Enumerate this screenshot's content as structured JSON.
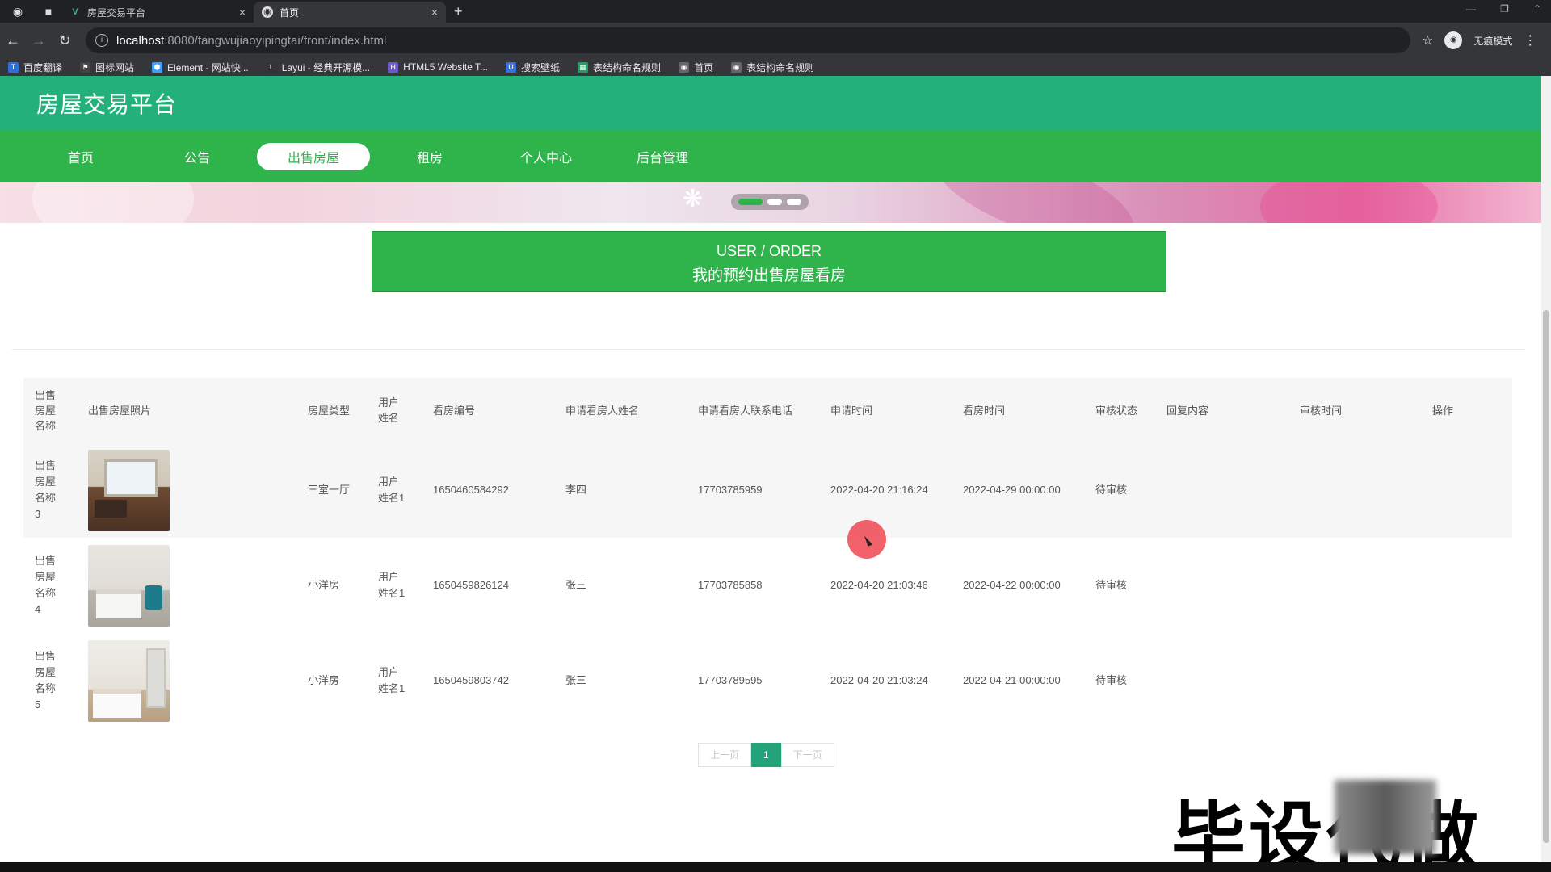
{
  "browser": {
    "tabs": [
      {
        "label": "房屋交易平台",
        "active": false
      },
      {
        "label": "首页",
        "active": true
      }
    ],
    "url_host": "localhost",
    "url_path": ":8080/fangwujiaoyipingtai/front/index.html",
    "incognito_label": "无痕模式",
    "bookmarks": [
      "百度翻译",
      "图标网站",
      "Element - 网站快...",
      "Layui - 经典开源模...",
      "HTML5 Website T...",
      "搜索壁纸",
      "表结构命名规则",
      "首页",
      "表结构命名规则"
    ]
  },
  "site": {
    "title": "房屋交易平台",
    "nav": [
      "首页",
      "公告",
      "出售房屋",
      "租房",
      "个人中心",
      "后台管理"
    ],
    "active_nav": "出售房屋"
  },
  "section": {
    "title_en": "USER / ORDER",
    "title_cn": "我的预约出售房屋看房"
  },
  "table": {
    "headers": [
      "出售房屋名称",
      "出售房屋照片",
      "房屋类型",
      "用户姓名",
      "看房编号",
      "申请看房人姓名",
      "申请看房人联系电话",
      "申请时间",
      "看房时间",
      "审核状态",
      "回复内容",
      "审核时间",
      "操作"
    ],
    "rows": [
      {
        "name": "出售房屋名称3",
        "photo": "living-room-photo",
        "type": "三室一厅",
        "user": "用户姓名1",
        "view_no": "1650460584292",
        "applicant": "李四",
        "phone": "17703785959",
        "apply_time": "2022-04-20 21:16:24",
        "view_time": "2022-04-29 00:00:00",
        "status": "待审核",
        "reply": "",
        "review_time": "",
        "action": ""
      },
      {
        "name": "出售房屋名称4",
        "photo": "bedroom-photo",
        "type": "小洋房",
        "user": "用户姓名1",
        "view_no": "1650459826124",
        "applicant": "张三",
        "phone": "17703785858",
        "apply_time": "2022-04-20 21:03:46",
        "view_time": "2022-04-22 00:00:00",
        "status": "待审核",
        "reply": "",
        "review_time": "",
        "action": ""
      },
      {
        "name": "出售房屋名称5",
        "photo": "bedroom-mirror-photo",
        "type": "小洋房",
        "user": "用户姓名1",
        "view_no": "1650459803742",
        "applicant": "张三",
        "phone": "17703789595",
        "apply_time": "2022-04-20 21:03:24",
        "view_time": "2022-04-21 00:00:00",
        "status": "待审核",
        "reply": "",
        "review_time": "",
        "action": ""
      }
    ]
  },
  "pager": {
    "prev": "上一页",
    "current": "1",
    "next": "下一页"
  },
  "watermark": "毕设代做",
  "colors": {
    "header": "#23b07a",
    "nav": "#2fb34b",
    "accent": "#23a37a",
    "cursor": "#ee4650"
  }
}
